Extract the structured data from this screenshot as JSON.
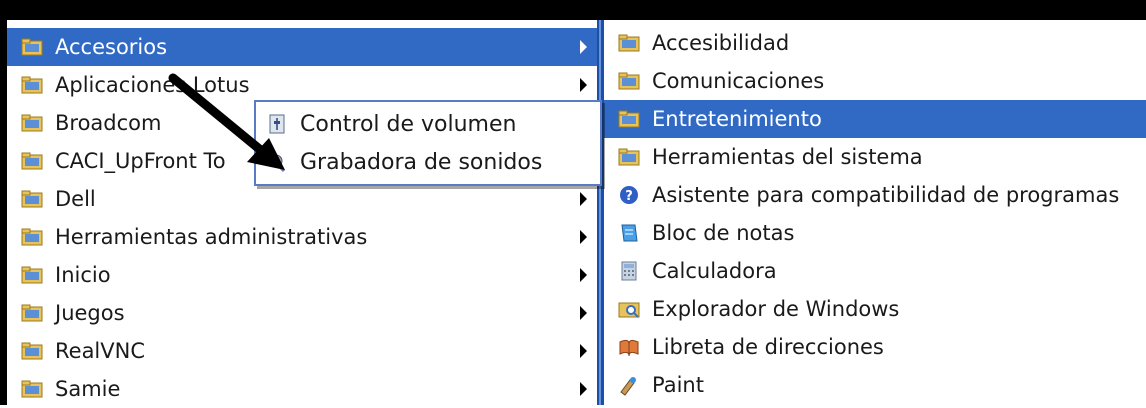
{
  "programs_menu": {
    "items": [
      {
        "label": "Accesorios",
        "icon": "folder-icon"
      },
      {
        "label": "Aplicaciones Lotus",
        "icon": "folder-icon"
      },
      {
        "label": "Broadcom",
        "icon": "folder-icon"
      },
      {
        "label": "CACI_UpFront To",
        "icon": "folder-icon"
      },
      {
        "label": "Dell",
        "icon": "folder-icon"
      },
      {
        "label": "Herramientas administrativas",
        "icon": "folder-icon"
      },
      {
        "label": "Inicio",
        "icon": "folder-icon"
      },
      {
        "label": "Juegos",
        "icon": "folder-icon"
      },
      {
        "label": "RealVNC",
        "icon": "folder-icon"
      },
      {
        "label": "Samie",
        "icon": "folder-icon"
      }
    ],
    "selected": "Accesorios"
  },
  "accesorios_menu": {
    "items": [
      {
        "label": "Accesibilidad",
        "icon": "folder-icon"
      },
      {
        "label": "Comunicaciones",
        "icon": "folder-icon"
      },
      {
        "label": "Entretenimiento",
        "icon": "folder-icon"
      },
      {
        "label": "Herramientas del sistema",
        "icon": "folder-icon"
      },
      {
        "label": "Asistente para compatibilidad de programas",
        "icon": "help-icon"
      },
      {
        "label": "Bloc de notas",
        "icon": "notepad-icon"
      },
      {
        "label": "Calculadora",
        "icon": "calculator-icon"
      },
      {
        "label": "Explorador de Windows",
        "icon": "explorer-icon"
      },
      {
        "label": "Libreta de direcciones",
        "icon": "address-book-icon"
      },
      {
        "label": "Paint",
        "icon": "paint-icon"
      }
    ],
    "selected": "Entretenimiento"
  },
  "entretenimiento_flyout": {
    "items": [
      {
        "label": "Control de volumen",
        "icon": "volume-control-icon"
      },
      {
        "label": "Grabadora de sonidos",
        "icon": "sound-recorder-icon"
      }
    ]
  },
  "colors": {
    "selection": "#316ac5",
    "frame": "#000000"
  }
}
